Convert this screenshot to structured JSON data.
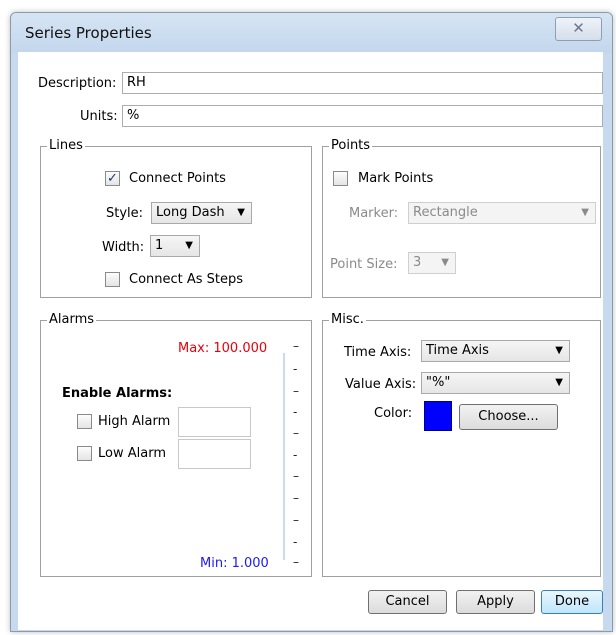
{
  "window": {
    "title": "Series Properties",
    "close_glyph": "✕"
  },
  "fields": {
    "description_label": "Description:",
    "description_value": "RH",
    "units_label": "Units:",
    "units_value": "%"
  },
  "lines": {
    "title": "Lines",
    "connect_points_label": "Connect Points",
    "connect_points_checked": true,
    "style_label": "Style:",
    "style_value": "Long Dash",
    "width_label": "Width:",
    "width_value": "1",
    "connect_as_steps_label": "Connect As Steps",
    "connect_as_steps_checked": false
  },
  "points": {
    "title": "Points",
    "mark_points_label": "Mark Points",
    "mark_points_checked": false,
    "marker_label": "Marker:",
    "marker_value": "Rectangle",
    "point_size_label": "Point Size:",
    "point_size_value": "3"
  },
  "alarms": {
    "title": "Alarms",
    "max_label": "Max: 100.000",
    "min_label": "Min: 1.000",
    "enable_label": "Enable Alarms:",
    "high_alarm_label": "High Alarm",
    "low_alarm_label": "Low Alarm",
    "max_color": "#e8000b",
    "min_color": "#1a1aff"
  },
  "misc": {
    "title": "Misc.",
    "time_axis_label": "Time Axis:",
    "time_axis_value": "Time Axis",
    "value_axis_label": "Value Axis:",
    "value_axis_value": "\"%\"",
    "color_label": "Color:",
    "color_value": "#0000ff",
    "choose_label": "Choose..."
  },
  "buttons": {
    "cancel": "Cancel",
    "apply": "Apply",
    "done": "Done"
  },
  "icons": {
    "dropdown": "▼",
    "check": "✓"
  }
}
